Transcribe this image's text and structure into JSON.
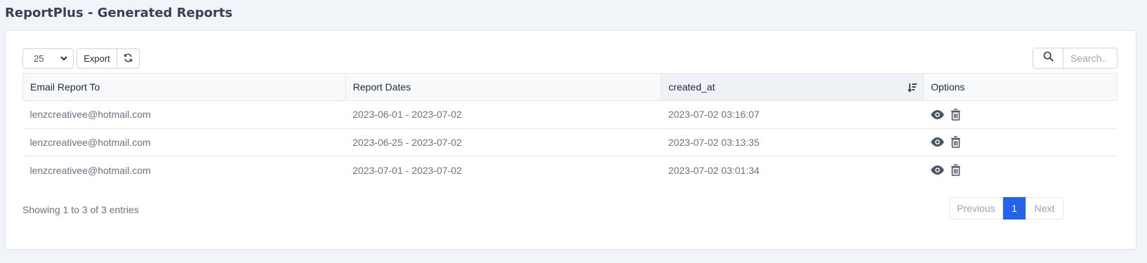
{
  "page": {
    "title": "ReportPlus - Generated Reports"
  },
  "toolbar": {
    "page_length": "25",
    "export_label": "Export",
    "search_placeholder": "Search.."
  },
  "table": {
    "columns": [
      "Email Report To",
      "Report Dates",
      "created_at",
      "Options"
    ],
    "sorted_column": "created_at",
    "rows": [
      {
        "email": "lenzcreativee@hotmail.com",
        "dates": "2023-06-01 - 2023-07-02",
        "created_at": "2023-07-02 03:16:07"
      },
      {
        "email": "lenzcreativee@hotmail.com",
        "dates": "2023-06-25 - 2023-07-02",
        "created_at": "2023-07-02 03:13:35"
      },
      {
        "email": "lenzcreativee@hotmail.com",
        "dates": "2023-07-01 - 2023-07-02",
        "created_at": "2023-07-02 03:01:34"
      }
    ]
  },
  "footer": {
    "info": "Showing 1 to 3 of 3 entries",
    "previous_label": "Previous",
    "current_page": "1",
    "next_label": "Next"
  },
  "colors": {
    "accent": "#2563eb",
    "icon": "#4b5563"
  },
  "icons": {
    "view": "eye-icon",
    "delete": "trash-icon",
    "search": "search-icon",
    "refresh": "refresh-icon",
    "sort": "sort-desc-icon"
  }
}
